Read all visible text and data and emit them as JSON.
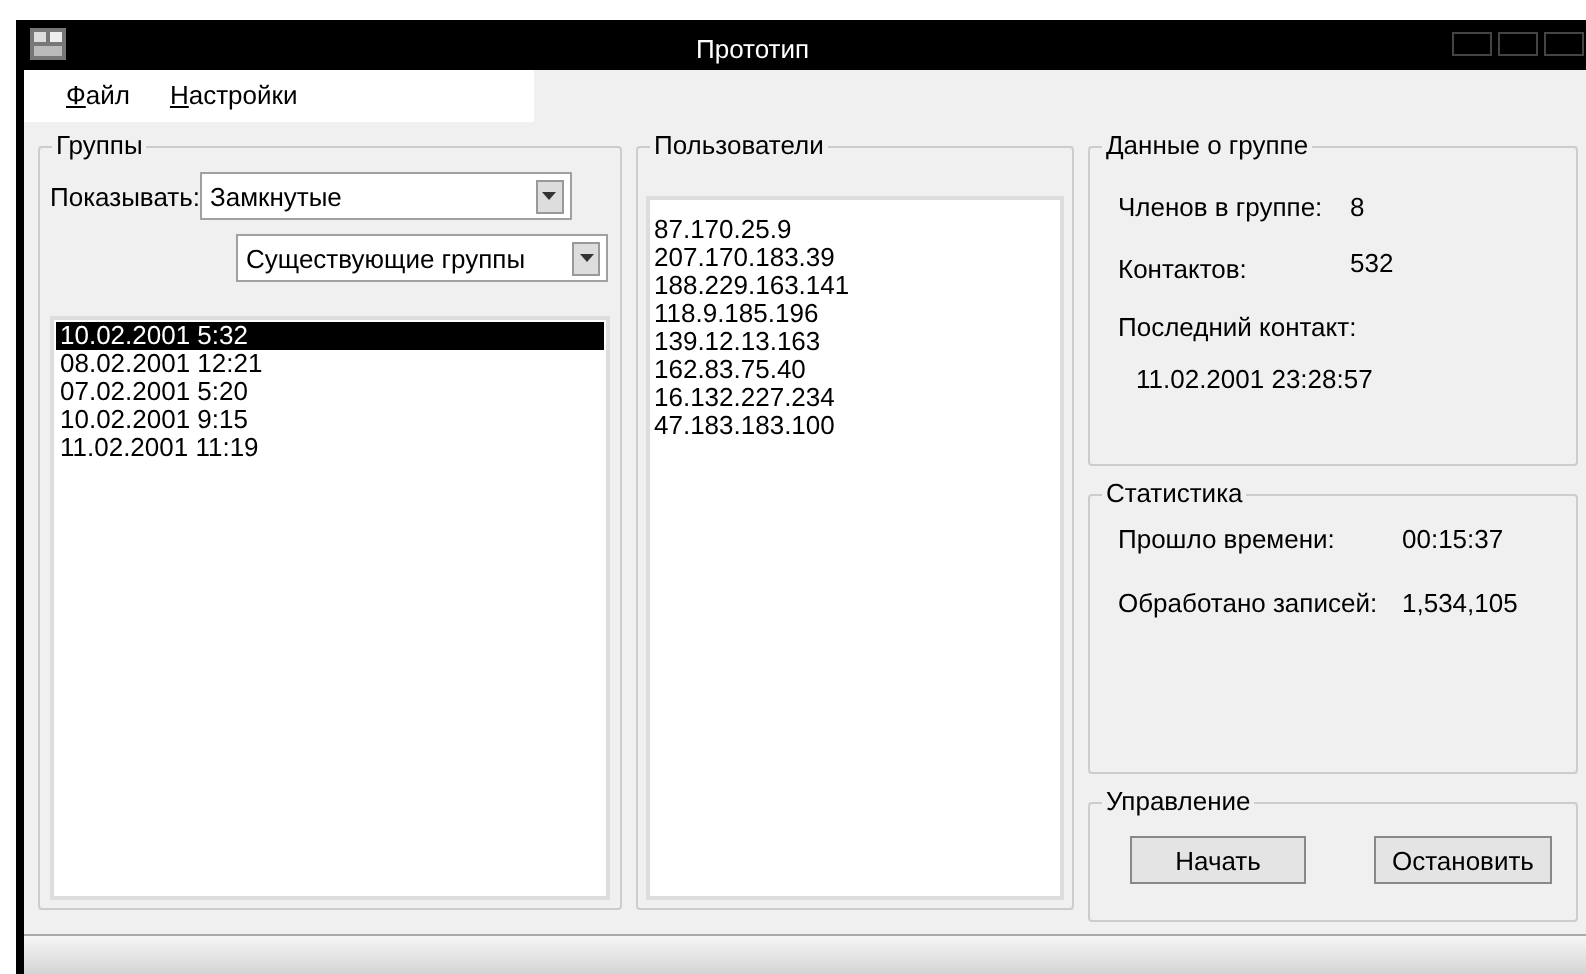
{
  "window": {
    "title": "Прототип"
  },
  "menu": [
    {
      "label": "Файл"
    },
    {
      "label": "Настройки"
    }
  ],
  "groups": {
    "title": "Группы",
    "show_label": "Показывать:",
    "filter1": "Замкнутые",
    "filter2": "Существующие группы",
    "items": [
      {
        "label": "10.02.2001 5:32",
        "selected": true
      },
      {
        "label": "08.02.2001 12:21",
        "selected": false
      },
      {
        "label": "07.02.2001 5:20",
        "selected": false
      },
      {
        "label": "10.02.2001 9:15",
        "selected": false
      },
      {
        "label": "11.02.2001 11:19",
        "selected": false
      }
    ]
  },
  "users": {
    "title": "Пользователи",
    "items": [
      "87.170.25.9",
      "207.170.183.39",
      "188.229.163.141",
      "118.9.185.196",
      "139.12.13.163",
      "162.83.75.40",
      "16.132.227.234",
      "47.183.183.100"
    ]
  },
  "group_info": {
    "title": "Данные о группе",
    "members_label": "Членов в группе:",
    "members": "8",
    "contacts_label": "Контактов:",
    "contacts": "532",
    "last_contact_label": "Последний контакт:",
    "last_contact": "11.02.2001 23:28:57"
  },
  "stats": {
    "title": "Статистика",
    "elapsed_label": "Прошло времени:",
    "elapsed": "00:15:37",
    "processed_label": "Обработано записей:",
    "processed": "1,534,105"
  },
  "control": {
    "title": "Управление",
    "buttons": [
      "Начать",
      "Остановить"
    ]
  }
}
